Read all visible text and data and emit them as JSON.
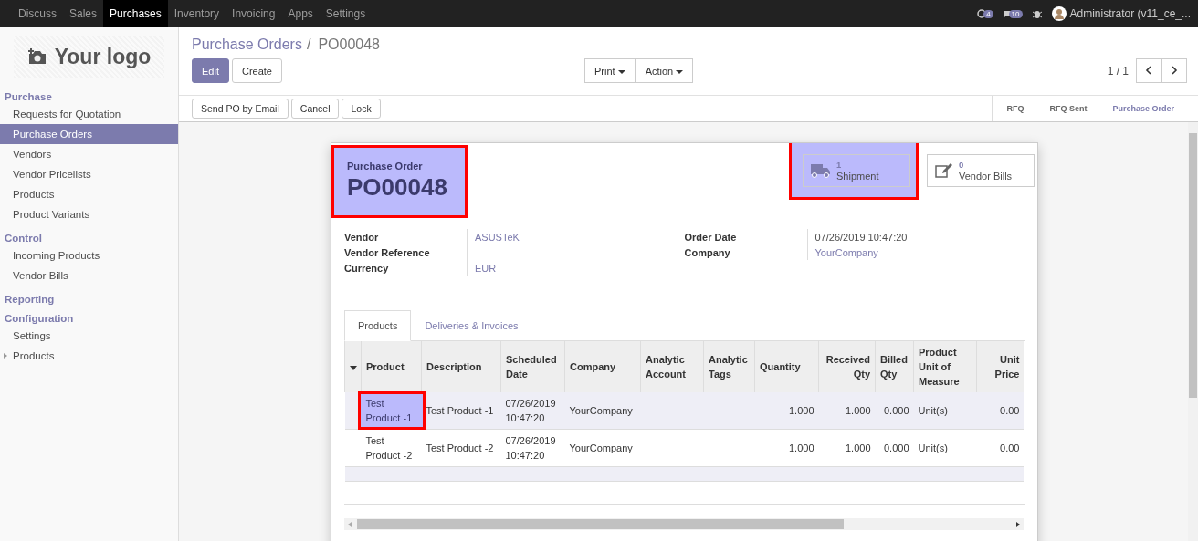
{
  "top_menu": [
    {
      "label": "Discuss",
      "selected": false
    },
    {
      "label": "Sales",
      "selected": false
    },
    {
      "label": "Purchases",
      "selected": true
    },
    {
      "label": "Inventory",
      "selected": false
    },
    {
      "label": "Invoicing",
      "selected": false
    },
    {
      "label": "Apps",
      "selected": false
    },
    {
      "label": "Settings",
      "selected": false
    }
  ],
  "systray": {
    "activity_count": "4",
    "message_count": "10",
    "user": "Administrator (v11_ce_..."
  },
  "sidebar": {
    "logo": "Your logo",
    "sections": [
      {
        "title": "Purchase",
        "items": [
          {
            "label": "Requests for Quotation",
            "selected": false,
            "expandable": false
          },
          {
            "label": "Purchase Orders",
            "selected": true,
            "expandable": false
          },
          {
            "label": "Vendors",
            "selected": false,
            "expandable": false
          },
          {
            "label": "Vendor Pricelists",
            "selected": false,
            "expandable": false
          },
          {
            "label": "Products",
            "selected": false,
            "expandable": false
          },
          {
            "label": "Product Variants",
            "selected": false,
            "expandable": false
          }
        ]
      },
      {
        "title": "Control",
        "items": [
          {
            "label": "Incoming Products",
            "selected": false,
            "expandable": false
          },
          {
            "label": "Vendor Bills",
            "selected": false,
            "expandable": false
          }
        ]
      },
      {
        "title": "Reporting"
      },
      {
        "title": "Configuration",
        "items": [
          {
            "label": "Settings",
            "selected": false,
            "expandable": false
          },
          {
            "label": "Products",
            "selected": false,
            "expandable": true
          }
        ]
      }
    ]
  },
  "breadcrumb": {
    "parent": "Purchase Orders",
    "separator": "/",
    "current": "PO00048"
  },
  "buttons": {
    "edit": "Edit",
    "create": "Create",
    "print": "Print",
    "action": "Action"
  },
  "pager": "1 / 1",
  "status_actions": [
    "Send PO by Email",
    "Cancel",
    "Lock"
  ],
  "stages": [
    {
      "label": "RFQ",
      "selected": false
    },
    {
      "label": "RFQ Sent",
      "selected": false
    },
    {
      "label": "Purchase Order",
      "selected": true
    }
  ],
  "form": {
    "caption": "Purchase Order",
    "name": "PO00048",
    "highlighted": true,
    "smart_buttons": [
      {
        "kind": "truck",
        "count": "1",
        "label": "Shipment",
        "highlighted": true
      },
      {
        "kind": "edit",
        "count": "0",
        "label": "Vendor Bills",
        "highlighted": false
      }
    ],
    "left_fields": [
      {
        "label": "Vendor",
        "value": "ASUSTeK"
      },
      {
        "label": "Vendor Reference"
      },
      {
        "label": "Currency",
        "value": "EUR"
      }
    ],
    "right_fields": [
      {
        "label": "Order Date",
        "value": "07/26/2019 10:47:20",
        "link": false
      },
      {
        "label": "Company",
        "value": "YourCompany",
        "link": true
      }
    ],
    "tabs": [
      {
        "label": "Products",
        "selected": true
      },
      {
        "label": "Deliveries & Invoices",
        "selected": false
      }
    ],
    "table": {
      "columns": [
        "Product",
        "Description",
        "Scheduled Date",
        "Company",
        "Analytic Account",
        "Analytic Tags",
        "Quantity",
        "Received Qty",
        "Billed Qty",
        "Product Unit of Measure",
        "Unit Price"
      ],
      "rows": [
        {
          "selected": true,
          "highlighted": true,
          "cells": [
            "Test Product -1",
            "Test Product -1",
            "07/26/2019 10:47:20",
            "YourCompany",
            "",
            "",
            "1.000",
            "1.000",
            "0.000",
            "Unit(s)",
            "0.00"
          ]
        },
        {
          "selected": false,
          "highlighted": false,
          "cells": [
            "Test Product -2",
            "Test Product -2",
            "07/26/2019 10:47:20",
            "YourCompany",
            "",
            "",
            "1.000",
            "1.000",
            "0.000",
            "Unit(s)",
            "0.00"
          ]
        }
      ]
    }
  }
}
